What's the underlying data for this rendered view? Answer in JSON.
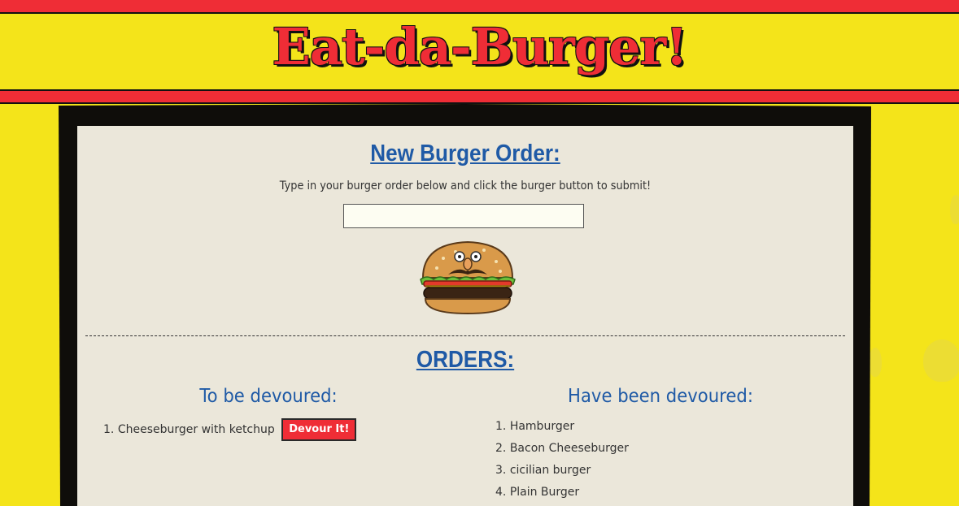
{
  "header": {
    "title": "Eat-da-Burger!"
  },
  "new_order": {
    "title": "New Burger Order:",
    "instructions": "Type in your burger order below and click the burger button to submit!",
    "input_value": "",
    "burger_button_icon": "burger-icon"
  },
  "orders": {
    "title": "ORDERS:",
    "to_be_devoured": {
      "title": "To be devoured:",
      "items": [
        {
          "index": "1.",
          "name": "Cheeseburger with ketchup",
          "button": "Devour It!"
        }
      ]
    },
    "devoured": {
      "title": "Have been devoured:",
      "items": [
        {
          "index": "1.",
          "name": "Hamburger"
        },
        {
          "index": "2.",
          "name": "Bacon Cheeseburger"
        },
        {
          "index": "3.",
          "name": "cicilian burger"
        },
        {
          "index": "4.",
          "name": "Plain Burger"
        }
      ]
    }
  },
  "colors": {
    "red": "#ef2d36",
    "yellow": "#f4e41a",
    "blue": "#1f5aa6",
    "panel": "#ebe7da"
  }
}
